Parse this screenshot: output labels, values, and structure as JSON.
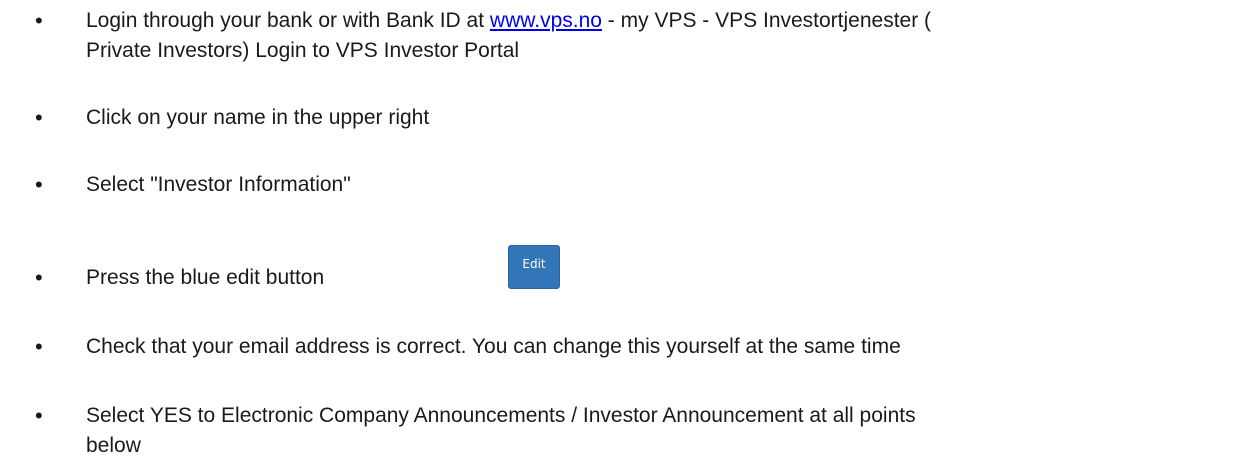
{
  "bullet_glyph": "•",
  "steps": {
    "step1": {
      "before_link": "Login through your bank or with Bank ID at ",
      "link_text": "www.vps.no",
      "after_link": " - my VPS - VPS Investortjenester (",
      "line2": "Private Investors) Login to VPS Investor Portal"
    },
    "step2": {
      "text": "Click on your name in the upper right"
    },
    "step3": {
      "text": "Select \"Investor Information\""
    },
    "step4": {
      "text": "Press the blue edit button",
      "button_label": "Edit"
    },
    "step5": {
      "text": "Check that your email address is correct. You can change this yourself at the same time"
    },
    "step6": {
      "line1": "Select YES to Electronic Company Announcements / Investor Announcement at all points",
      "line2": "below"
    }
  },
  "colors": {
    "link": "#0000ee",
    "edit_button": "#3275b8",
    "text": "#1a1a1a"
  }
}
